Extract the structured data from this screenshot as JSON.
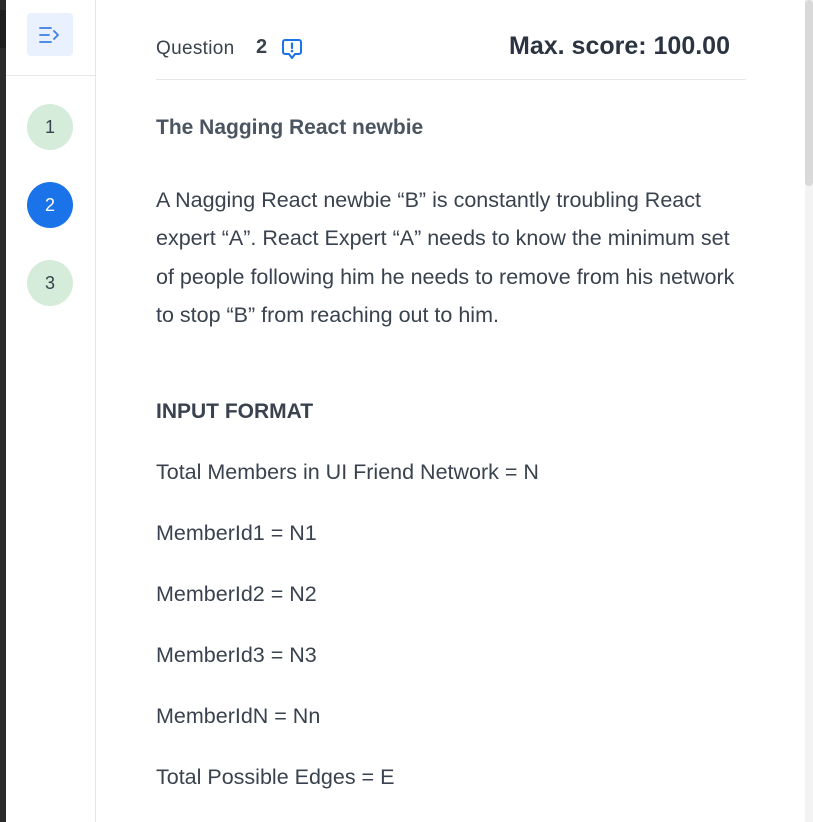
{
  "sidebar": {
    "toggle_icon": "collapse-sidebar-icon",
    "questions": [
      {
        "number": "1",
        "status": "done"
      },
      {
        "number": "2",
        "status": "active"
      },
      {
        "number": "3",
        "status": "done"
      }
    ]
  },
  "header": {
    "question_label": "Question",
    "question_number": "2",
    "report_icon": "report-issue-icon",
    "max_score": "Max. score: 100.00"
  },
  "problem": {
    "title": "The Nagging React newbie",
    "description": "A Nagging React newbie “B” is constantly troubling React expert “A”. React Expert “A” needs to know the minimum set of people following him he needs to remove from his network to stop “B” from reaching out to him.",
    "input_format_heading": "INPUT FORMAT",
    "input_lines": [
      "Total Members in UI Friend Network = N",
      "MemberId1 = N1",
      "MemberId2 = N2",
      "MemberId3 = N3",
      "MemberIdN = Nn",
      "Total Possible Edges = E"
    ]
  },
  "colors": {
    "accent": "#1a73e8",
    "done_badge": "#d4ecd9",
    "toggle_bg": "#e8f1fd"
  }
}
